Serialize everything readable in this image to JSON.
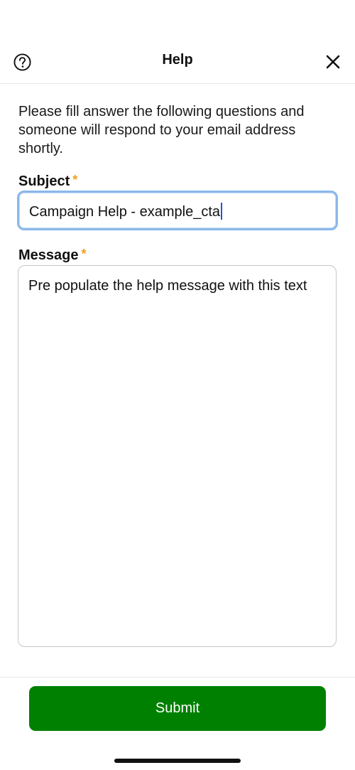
{
  "header": {
    "title": "Help",
    "left_icon": "question-circle-icon",
    "right_icon": "close-icon"
  },
  "intro_text": "Please fill answer the following questions and someone will respond to your email address shortly.",
  "subject": {
    "label": "Subject",
    "required_mark": "*",
    "value": "Campaign Help - example_cta"
  },
  "message": {
    "label": "Message",
    "required_mark": "*",
    "value": "Pre populate the help message with this text"
  },
  "footer": {
    "submit_label": "Submit"
  },
  "colors": {
    "primary": "#008000",
    "required": "#f0a020",
    "focus_border": "#8ab8ea"
  }
}
